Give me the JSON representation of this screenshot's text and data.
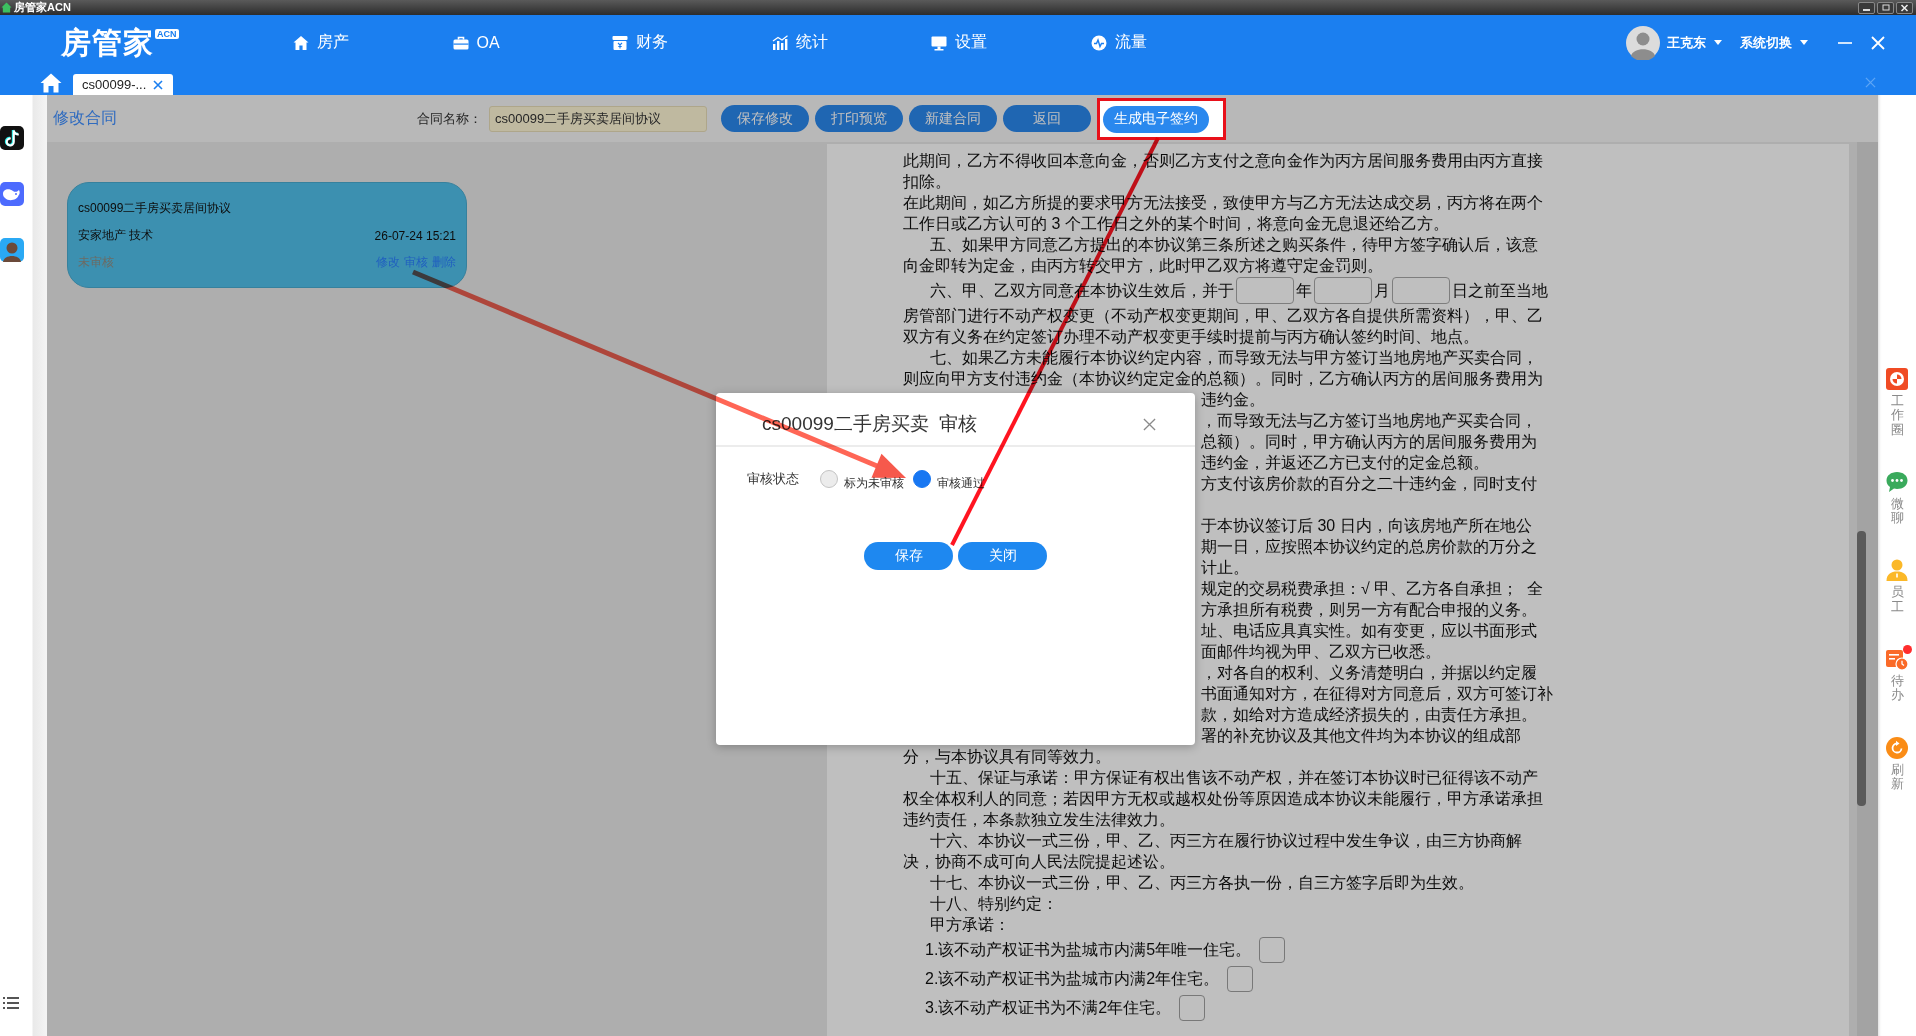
{
  "window": {
    "title": "房管家ACN"
  },
  "header": {
    "logo": "房管家",
    "logo_badge": "ACN",
    "nav": [
      {
        "label": "房产"
      },
      {
        "label": "OA"
      },
      {
        "label": "财务"
      },
      {
        "label": "统计"
      },
      {
        "label": "设置"
      },
      {
        "label": "流量"
      }
    ],
    "user": "王克东",
    "system_switch": "系统切换"
  },
  "tabs": [
    {
      "label": "cs00099-...",
      "selected": true
    }
  ],
  "toolbar": {
    "title": "修改合同",
    "contract_name_label": "合同名称：",
    "contract_name": "cs00099二手房买卖居间协议",
    "buttons": [
      {
        "label": "保存修改",
        "highlighted": false
      },
      {
        "label": "打印预览",
        "highlighted": false
      },
      {
        "label": "新建合同",
        "highlighted": false
      },
      {
        "label": "返回",
        "highlighted": false
      },
      {
        "label": "生成电子签约",
        "highlighted": true
      }
    ]
  },
  "contract_card": {
    "title": "cs00099二手房买卖居间协议",
    "company": "安家地产 技术",
    "time": "26-07-24 15:21",
    "status": "未审核",
    "actions": [
      "修改",
      "审核",
      "删除"
    ]
  },
  "document": {
    "lines": [
      {
        "kind": "text",
        "text": "此期间，乙方不得收回本意向金，否则乙方支付之意向金作为丙方居间服务费用由丙方直接"
      },
      {
        "kind": "text",
        "text": "扣除。"
      },
      {
        "kind": "text",
        "text": "在此期间，如乙方所提的要求甲方无法接受，致使甲方与乙方无法达成交易，丙方将在两个"
      },
      {
        "kind": "text",
        "text": "工作日或乙方认可的 3 个工作日之外的某个时间，将意向金无息退还给乙方。"
      },
      {
        "kind": "paragraph",
        "text": "五、如果甲方同意乙方提出的本协议第三条所述之购买条件，待甲方签字确认后，该意"
      },
      {
        "kind": "text",
        "text": "向金即转为定金，由丙方转交甲方，此时甲乙双方将遵守定金罚则。"
      },
      {
        "kind": "dates",
        "parts": [
          "六、甲、乙双方同意在本协议生效后，并于",
          "年",
          "月",
          "日之前至当地"
        ]
      },
      {
        "kind": "text",
        "text": "房管部门进行不动产权变更（不动产权变更期间，甲、乙双方各自提供所需资料），甲、乙"
      },
      {
        "kind": "text",
        "text": "双方有义务在约定签订办理不动产权变更手续时提前与丙方确认签约时间、地点。"
      },
      {
        "kind": "paragraph",
        "text": "七、如果乙方未能履行本协议约定内容，而导致无法与甲方签订当地房地产买卖合同，"
      },
      {
        "kind": "text",
        "text": "则应向甲方支付违约金（本协议约定定金的总额）。同时，乙方确认丙方的居间服务费用为"
      },
      {
        "kind": "fragment",
        "text": "违约金。"
      },
      {
        "kind": "fragment",
        "text": "，而导致无法与乙方签订当地房地产买卖合同，"
      },
      {
        "kind": "fragment",
        "text": "总额）。同时，甲方确认丙方的居间服务费用为"
      },
      {
        "kind": "fragment",
        "text": "违约金，并返还乙方已支付的定金总额。"
      },
      {
        "kind": "fragment",
        "text": "方支付该房价款的百分之二十违约金，同时支付"
      },
      {
        "kind": "gap"
      },
      {
        "kind": "fragment",
        "text": "于本协议签订后 30 日内，向该房地产所在地公"
      },
      {
        "kind": "fragment",
        "text": "期一日，应按照本协议约定的总房价款的万分之"
      },
      {
        "kind": "fragment",
        "text": "计止。"
      },
      {
        "kind": "fragment",
        "text": "规定的交易税费承担：√ 甲、乙方各自承担；  全"
      },
      {
        "kind": "fragment",
        "text": "方承担所有税费，则另一方有配合申报的义务。"
      },
      {
        "kind": "fragment",
        "text": "址、电话应具真实性。如有变更，应以书面形式"
      },
      {
        "kind": "fragment",
        "text": "面邮件均视为甲、乙双方已收悉。"
      },
      {
        "kind": "fragment",
        "text": "，对各自的权利、义务清楚明白，并据以约定履"
      },
      {
        "kind": "fragment",
        "text": "书面通知对方，在征得对方同意后，双方可签订补"
      },
      {
        "kind": "fragment",
        "text": "款，如给对方造成经济损失的，由责任方承担。"
      },
      {
        "kind": "fragment",
        "text": "署的补充协议及其他文件均为本协议的组成部"
      },
      {
        "kind": "text",
        "text": "分，与本协议具有同等效力。"
      },
      {
        "kind": "paragraph",
        "text": "十五、保证与承诺：甲方保证有权出售该不动产权，并在签订本协议时已征得该不动产"
      },
      {
        "kind": "text",
        "text": "权全体权利人的同意；若因甲方无权或越权处份等原因造成本协议未能履行，甲方承诺承担"
      },
      {
        "kind": "text",
        "text": "违约责任，本条款独立发生法律效力。"
      },
      {
        "kind": "paragraph",
        "text": "十六、本协议一式三份，甲、乙、丙三方在履行协议过程中发生争议，由三方协商解"
      },
      {
        "kind": "text",
        "text": "决，协商不成可向人民法院提起述讼。"
      },
      {
        "kind": "paragraph",
        "text": "十七、本协议一式三份，甲、乙、丙三方各执一份，自三方签字后即为生效。"
      },
      {
        "kind": "paragraph",
        "text": "十八、特别约定："
      },
      {
        "kind": "paragraph",
        "text": "甲方承诺："
      }
    ],
    "pledges": [
      {
        "text": "1.该不动产权证书为盐城市内满5年唯一住宅。",
        "checked": false
      },
      {
        "text": "2.该不动产权证书为盐城市内满2年住宅。",
        "checked": false
      },
      {
        "text": "3.该不动产权证书为不满2年住宅。",
        "checked": false
      }
    ]
  },
  "dialog": {
    "title": "cs00099二手房买卖  审核",
    "status_label": "审核状态",
    "options": [
      {
        "label": "标为未审核",
        "selected": false
      },
      {
        "label": "审核通过",
        "selected": true
      }
    ],
    "buttons": [
      "保存",
      "关闭"
    ]
  },
  "right_dock": [
    {
      "label": "工作圈",
      "notify": false
    },
    {
      "label": "微聊",
      "notify": false
    },
    {
      "label": "员工",
      "notify": false
    },
    {
      "label": "待办",
      "notify": true
    },
    {
      "label": "刷新",
      "notify": false
    }
  ],
  "annotations": [
    {
      "kind": "arrow"
    },
    {
      "kind": "line"
    }
  ]
}
